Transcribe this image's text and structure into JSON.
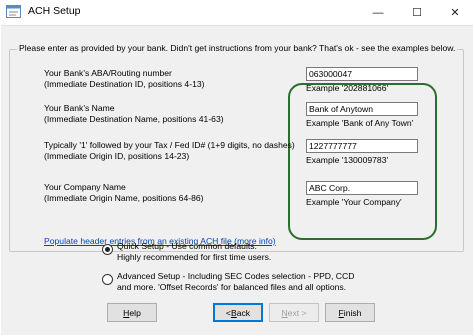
{
  "window": {
    "title": "ACH Setup",
    "controls": {
      "minimize": "—",
      "maximize": "☐",
      "close": "✕"
    }
  },
  "intro": "Please enter as provided by your bank.  Didn't get instructions from your bank?  That's ok - see the examples below.",
  "fields": [
    {
      "label1": "Your Bank's ABA/Routing number",
      "label2": "(Immediate Destination ID, positions 4-13)",
      "value": "063000047",
      "example": "Example '202881066'"
    },
    {
      "label1": "Your Bank's Name",
      "label2": "(Immediate Destination Name, positions 41-63)",
      "value": "Bank of Anytown",
      "example": "Example 'Bank of Any Town'"
    },
    {
      "label1": "Typically '1' followed by your Tax / Fed ID# (1+9 digits, no dashes)",
      "label2": "(Immediate Origin ID, positions 14-23)",
      "value": "1227777777",
      "example": "Example '130009783'"
    },
    {
      "label1": "Your Company Name",
      "label2": "(Immediate Origin Name, positions 64-86)",
      "value": "ABC Corp.",
      "example": "Example 'Your Company'"
    }
  ],
  "populate_link": "Populate header entries from an existing ACH file (more info)",
  "setup_options": [
    {
      "line1": "Quick Setup - Use common defaults.",
      "line2": "Highly recommended for first time users.",
      "selected": true
    },
    {
      "line1": "Advanced Setup - Including SEC Codes selection - PPD, CCD",
      "line2": "and more. 'Offset Records' for balanced files and all options.",
      "selected": false
    }
  ],
  "buttons": {
    "help": {
      "pre": "",
      "key": "H",
      "post": "elp"
    },
    "back": {
      "pre": "< ",
      "key": "B",
      "post": "ack"
    },
    "next": {
      "pre": "",
      "key": "N",
      "post": "ext >"
    },
    "finish": {
      "pre": "",
      "key": "F",
      "post": "inish"
    }
  },
  "colors": {
    "highlight_border": "#2d6e2d",
    "link": "#0645ad",
    "default_button_border": "#0078d7"
  }
}
